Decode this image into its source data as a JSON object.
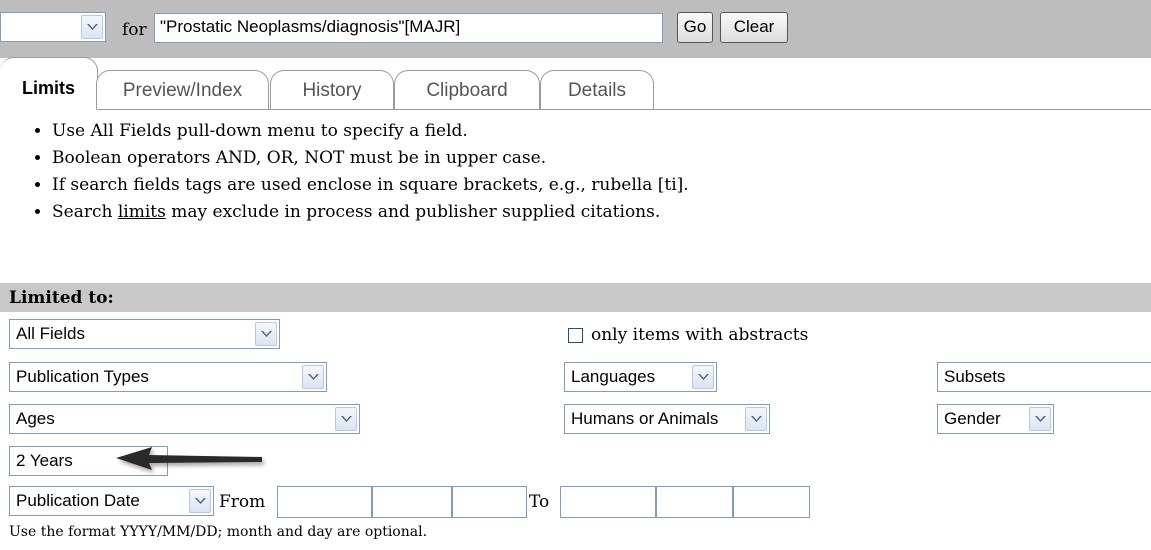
{
  "search": {
    "field_select": "",
    "for_label": "for",
    "query": "\"Prostatic Neoplasms/diagnosis\"[MAJR]",
    "go_label": "Go",
    "clear_label": "Clear"
  },
  "tabs": [
    {
      "label": "Limits",
      "active": true
    },
    {
      "label": "Preview/Index"
    },
    {
      "label": "History"
    },
    {
      "label": "Clipboard"
    },
    {
      "label": "Details"
    }
  ],
  "tips": {
    "tip1": "Use All Fields pull-down menu to specify a field.",
    "tip2": "Boolean operators AND, OR, NOT must be in upper case.",
    "tip3": "If search fields tags are used enclose in square brackets, e.g., rubella [ti].",
    "tip4_before": "Search ",
    "tip4_link": "limits",
    "tip4_after": " may exclude in process and publisher supplied citations."
  },
  "limits": {
    "heading": "Limited to:",
    "fields_select": "All Fields",
    "abstracts_label": "only items with abstracts",
    "abstracts_checked": false,
    "pubtypes_select": "Publication Types",
    "languages_select": "Languages",
    "subsets_select": "Subsets",
    "ages_select": "Ages",
    "humans_select": "Humans or Animals",
    "gender_select": "Gender",
    "years_select": "2 Years",
    "pubdate_select": "Publication Date",
    "from_label": "From",
    "to_label": "To",
    "date_hint": "Use the format YYYY/MM/DD; month and day are optional."
  },
  "colors": {
    "bar_gray": "#bdbdbd",
    "limited_gray": "#c8c8c8",
    "field_border": "#7f9db9",
    "arrow": "#2a2a2a"
  }
}
